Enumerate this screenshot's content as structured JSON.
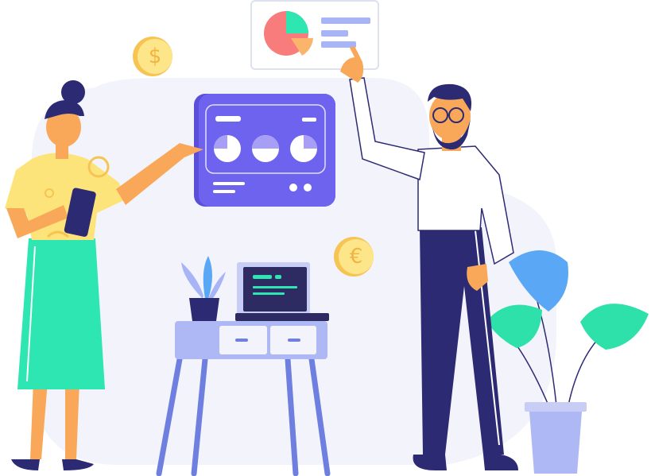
{
  "illustration": {
    "coins": [
      {
        "symbol": "$"
      },
      {
        "symbol": "€"
      }
    ],
    "colors": {
      "backdrop": "#f3f4fb",
      "dashboard_card": "#6d63ee",
      "dashboard_card_dark": "#5a4fd8",
      "coin": "#fde68a",
      "coin_rim": "#f6c453",
      "skirt": "#2ee6b1",
      "shirt_yellow": "#fde47a",
      "trousers": "#2c2a72",
      "hair": "#2c2a72",
      "skin": "#f9a85a",
      "leaf_blue": "#5aa8f5",
      "leaf_green": "#2ee0a9",
      "pie_red": "#f97c7c",
      "pie_teal": "#2ee6b1",
      "pie_orange": "#fbb46b",
      "bars": "#a7b4f6",
      "desk": "#aeb8f4",
      "screen": "#2d2b62"
    }
  }
}
